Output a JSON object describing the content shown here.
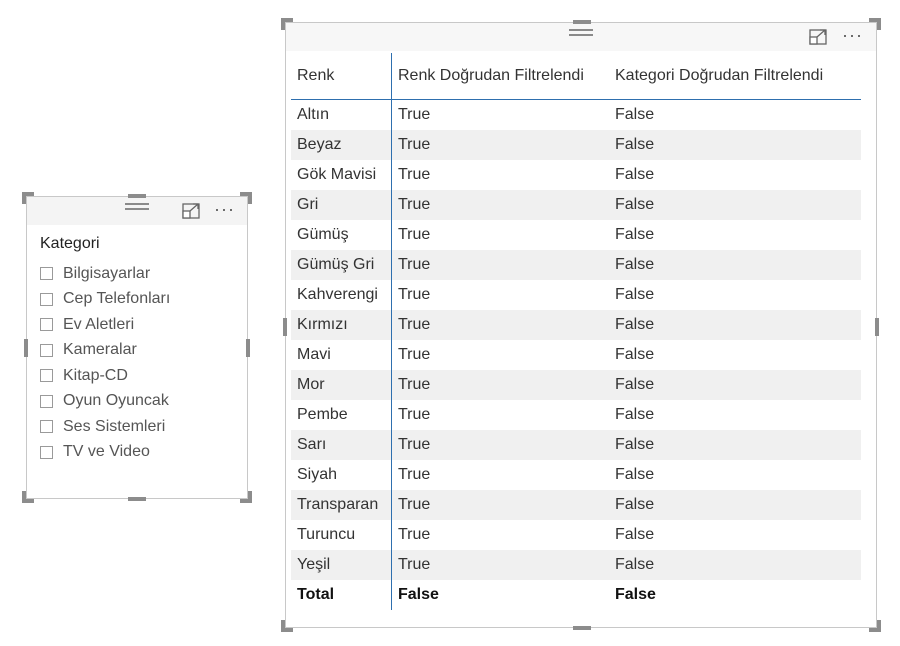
{
  "slicer": {
    "title": "Kategori",
    "items": [
      "Bilgisayarlar",
      "Cep Telefonları",
      "Ev Aletleri",
      "Kameralar",
      "Kitap-CD",
      "Oyun Oyuncak",
      "Ses Sistemleri",
      "TV ve Video"
    ],
    "more_label": "···"
  },
  "table": {
    "columns": [
      "Renk",
      "Renk Doğrudan Filtrelendi",
      "Kategori Doğrudan Filtrelendi"
    ],
    "rows": [
      [
        "Altın",
        "True",
        "False"
      ],
      [
        "Beyaz",
        "True",
        "False"
      ],
      [
        "Gök Mavisi",
        "True",
        "False"
      ],
      [
        "Gri",
        "True",
        "False"
      ],
      [
        "Gümüş",
        "True",
        "False"
      ],
      [
        "Gümüş Gri",
        "True",
        "False"
      ],
      [
        "Kahverengi",
        "True",
        "False"
      ],
      [
        "Kırmızı",
        "True",
        "False"
      ],
      [
        "Mavi",
        "True",
        "False"
      ],
      [
        "Mor",
        "True",
        "False"
      ],
      [
        "Pembe",
        "True",
        "False"
      ],
      [
        "Sarı",
        "True",
        "False"
      ],
      [
        "Siyah",
        "True",
        "False"
      ],
      [
        "Transparan",
        "True",
        "False"
      ],
      [
        "Turuncu",
        "True",
        "False"
      ],
      [
        "Yeşil",
        "True",
        "False"
      ]
    ],
    "total": [
      "Total",
      "False",
      "False"
    ],
    "more_label": "···"
  },
  "colors": {
    "accent_line": "#2e6fae",
    "stripe": "#f0f0f0",
    "handle": "#8c8c8c"
  }
}
